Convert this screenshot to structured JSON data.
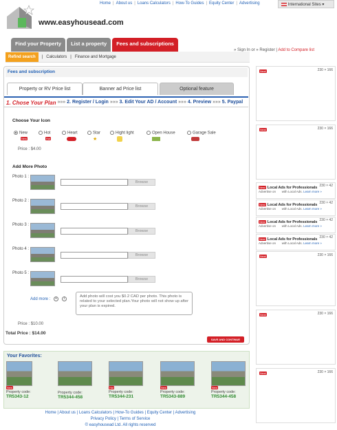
{
  "top_nav": [
    "Home",
    "About us",
    "Loans Calculators",
    "How-To Guides",
    "Equity Center",
    "Advertising"
  ],
  "intl_label": "International Sites",
  "logo_text": "www.easyhousead.com",
  "main_tabs": [
    "Find your Property",
    "List a property",
    "Fees and subscriptions"
  ],
  "sub_nav": {
    "refind": "Refind search",
    "calc": "Calculators",
    "finance": "Finance and Mortgage"
  },
  "right_links": {
    "sign_in": "Sign In",
    "or": "or",
    "register": "Register",
    "compare": "Add to Compare list"
  },
  "panel_title": "Fees and subscription",
  "panel_tabs": [
    "Property or RV Price list",
    "Banner ad Price list",
    "Optional feature"
  ],
  "steps": {
    "s1": "1. Chose Your Plan",
    "s2": "2. Register / Login",
    "s3": "3. Edit Your AD / Account",
    "s4": "4. Preview",
    "s5": "5. Paypal"
  },
  "choose_icon": {
    "title": "Choose Your Icon",
    "options": [
      "New",
      "Hot",
      "Heart",
      "Star",
      "Hight light",
      "Open House",
      "Garage Sale"
    ],
    "price_label": "Price :",
    "price_value": "$4.00"
  },
  "add_photo": {
    "title": "Add More Photo",
    "photos": [
      "Photo 1 :",
      "Photo 2 :",
      "Photo 3 :",
      "Photo 4 :",
      "Photo 5 :"
    ],
    "browse": "Browse",
    "add_more": "Add more :",
    "tooltip": "Add photo will cost you $0.2 CAD per photo. This photo is related to your selected plan.Your photo will not show up after your plan is expired.",
    "price_label": "Price :",
    "price_value": "$10.00"
  },
  "total": {
    "label": "Total Price :",
    "value": "$14.00"
  },
  "save_btn": "SAVE AND CONTINUE",
  "favorites": {
    "title": "Your Favorites:",
    "code_label": "Property code:",
    "items": [
      "TR5343-12",
      "TR5344-458",
      "TR5344-231",
      "TR5343-889",
      "TR5344-458"
    ]
  },
  "footer": {
    "links": [
      "Home",
      "About us",
      "Loans Calculators",
      "How-To Guides",
      "Equity Center",
      "Advertising"
    ],
    "links2": [
      "Privacy Policy",
      "Terms of Service"
    ],
    "copyright": "© easyhousead Ltd. All rights reserved"
  },
  "ads": {
    "size_big": "230 × 166",
    "size_small": "230 × 42",
    "pro_title": "Local Ads for Professionals",
    "advertise_on": "Advertise on",
    "with_local": "with Local Ads.",
    "learn_more": "Learn more »",
    "new_badge": "New!"
  },
  "badges": {
    "new": "New",
    "hot": "Hot"
  },
  "colors": {
    "accent_red": "#d31f26",
    "link_blue": "#1f5fb4",
    "orange": "#f4a11d"
  }
}
